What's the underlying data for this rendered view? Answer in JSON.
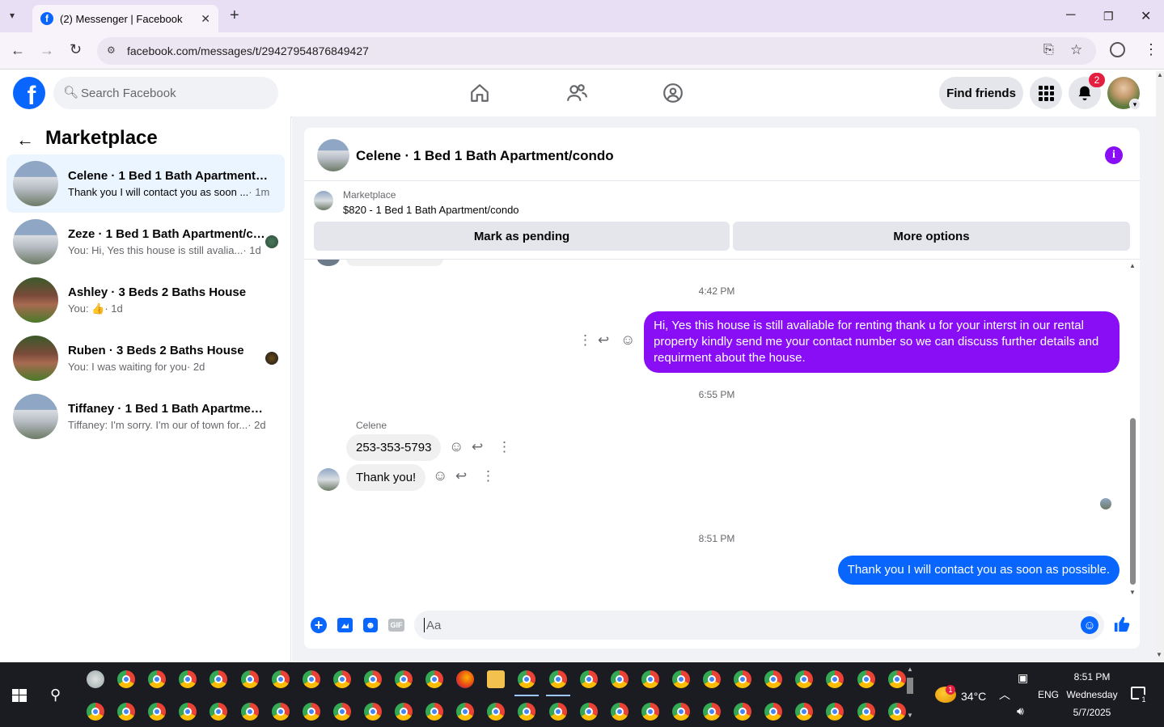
{
  "browser": {
    "tab_title": "(2) Messenger | Facebook",
    "url": "facebook.com/messages/t/29427954876849427"
  },
  "header": {
    "search_placeholder": "Search Facebook",
    "find_friends": "Find friends",
    "notification_count": "2"
  },
  "sidebar": {
    "title": "Marketplace",
    "conversations": [
      {
        "name": "Celene · 1 Bed 1 Bath Apartment/condo",
        "snippet": "Thank you I will contact you as soon ...",
        "time": " · 1m"
      },
      {
        "name": "Zeze · 1 Bed 1 Bath Apartment/condo",
        "snippet": "You: Hi, Yes this house is still avalia...",
        "time": " · 1d"
      },
      {
        "name": "Ashley · 3 Beds 2 Baths House",
        "snippet": "You: 👍",
        "time": " · 1d"
      },
      {
        "name": "Ruben · 3 Beds 2 Baths House",
        "snippet": "You: I was waiting for you",
        "time": " · 2d"
      },
      {
        "name": "Tiffaney · 1 Bed 1 Bath Apartment/condo",
        "snippet": "Tiffaney: I'm sorry. I'm our of town for...",
        "time": " · 2d"
      }
    ]
  },
  "chat": {
    "title": "Celene · 1 Bed 1 Bath Apartment/condo",
    "listing_source": "Marketplace",
    "listing": "$820 - 1 Bed 1 Bath Apartment/condo",
    "mark_pending": "Mark as pending",
    "more_options": "More options",
    "messages": {
      "ts1": "4:42 PM",
      "out1": "Hi, Yes this house is still avaliable for renting thank u for your interst in our rental property kindly send me your contact number so we can discuss further details and requirment about the house.",
      "ts2": "6:55 PM",
      "sender": "Celene",
      "in1": "253-353-5793",
      "in2": "Thank you!",
      "ts3": "8:51 PM",
      "out2": "Thank you I will contact  you as soon as possible."
    },
    "composer_placeholder": "Aa",
    "gif_label": "GIF"
  },
  "taskbar": {
    "weather": "34°C",
    "weather_badge": "1",
    "language": "ENG",
    "time": "8:51 PM",
    "day": "Wednesday",
    "date": "5/7/2025",
    "notification_badge": "1"
  },
  "colors": {
    "facebook_blue": "#0866ff",
    "messenger_purple": "#8a0ef5",
    "notification_red": "#e41e3f"
  }
}
